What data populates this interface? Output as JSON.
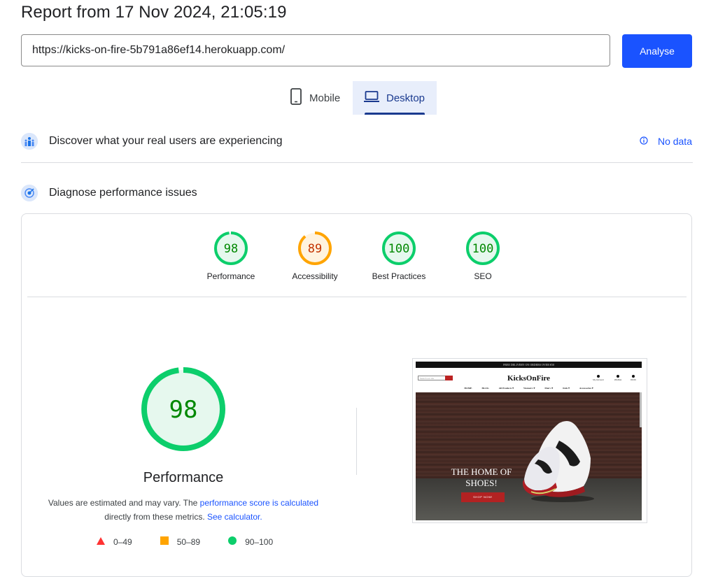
{
  "report_title": "Report from 17 Nov 2024, 21:05:19",
  "url_input": {
    "value": "https://kicks-on-fire-5b791a86ef14.herokuapp.com/"
  },
  "analyse_label": "Analyse",
  "tabs": [
    {
      "label": "Mobile",
      "icon": "phone-icon",
      "selected": false
    },
    {
      "label": "Desktop",
      "icon": "laptop-icon",
      "selected": true
    }
  ],
  "real_users": {
    "title": "Discover what your real users are experiencing",
    "no_data_label": "No data"
  },
  "diagnose": {
    "title": "Diagnose performance issues"
  },
  "scores": [
    {
      "label": "Performance",
      "value": "98",
      "score": 98,
      "color": "#0cce6b",
      "text_color": "#008800",
      "fill": "#e6f8ee"
    },
    {
      "label": "Accessibility",
      "value": "89",
      "score": 89,
      "color": "#ffa400",
      "text_color": "#c33300",
      "fill": "#fff3e0"
    },
    {
      "label": "Best Practices",
      "value": "100",
      "score": 100,
      "color": "#0cce6b",
      "text_color": "#008800",
      "fill": "#e6f8ee"
    },
    {
      "label": "SEO",
      "value": "100",
      "score": 100,
      "color": "#0cce6b",
      "text_color": "#008800",
      "fill": "#e6f8ee"
    }
  ],
  "performance": {
    "value": "98",
    "score": 98,
    "title": "Performance",
    "note_prefix": "Values are estimated and may vary. The ",
    "note_link1": "performance score is calculated",
    "note_middle": " directly from these metrics. ",
    "note_link2": "See calculator."
  },
  "legend": [
    {
      "label": "0–49",
      "shape": "triangle",
      "color": "#ff3333"
    },
    {
      "label": "50–89",
      "shape": "square",
      "color": "#ffa400"
    },
    {
      "label": "90–100",
      "shape": "circle",
      "color": "#0cce6b"
    }
  ],
  "screenshot": {
    "announcement": "FREE DELIVERY ON ORDERS OVER €50",
    "search_placeholder": "Search our site",
    "logo": "KicksOnFire",
    "account_items": [
      "My Account",
      "Wishlist",
      "€0.00"
    ],
    "nav": [
      "HOME",
      "BLOG",
      "All Products ▾",
      "Women's ▾",
      "Men's ▾",
      "Kids ▾",
      "Accessories ▾"
    ],
    "hero_text": "THE HOME OF SHOES!",
    "shop_button": "SHOP NOW!"
  },
  "colors": {
    "accent": "#1a53ff",
    "good": "#0cce6b",
    "average": "#ffa400",
    "poor": "#ff3333"
  }
}
